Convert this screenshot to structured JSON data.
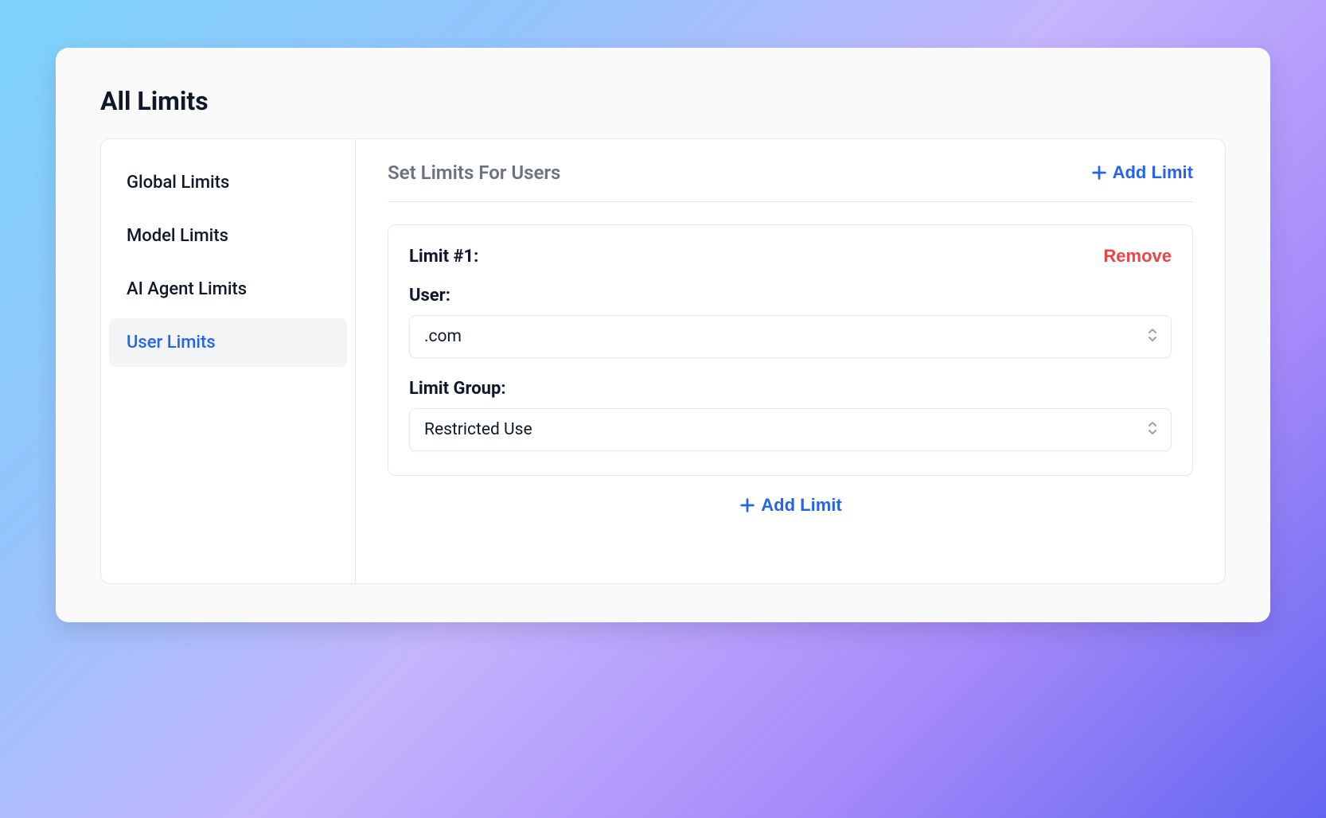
{
  "page": {
    "title": "All Limits"
  },
  "sidebar": {
    "items": [
      {
        "label": "Global Limits"
      },
      {
        "label": "Model Limits"
      },
      {
        "label": "AI Agent Limits"
      },
      {
        "label": "User Limits"
      }
    ],
    "active_index": 3
  },
  "main": {
    "section_title": "Set Limits For Users",
    "add_limit_label": "Add Limit",
    "limits": [
      {
        "title": "Limit #1:",
        "remove_label": "Remove",
        "fields": {
          "user": {
            "label": "User:",
            "value": ".com"
          },
          "limit_group": {
            "label": "Limit Group:",
            "value": "Restricted Use"
          }
        }
      }
    ]
  }
}
